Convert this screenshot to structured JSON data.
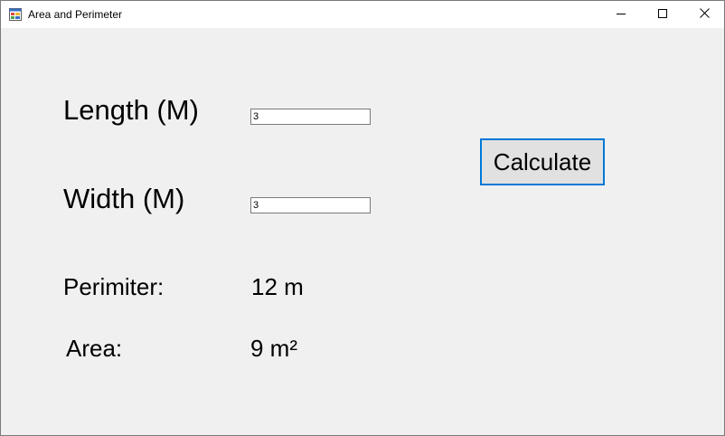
{
  "window": {
    "title": "Area and Perimeter",
    "app_icon": "windows-forms-app-icon",
    "accent_color": "#0078d7",
    "controls": {
      "minimize_icon": "minimize-icon",
      "maximize_icon": "maximize-icon",
      "close_icon": "close-icon"
    }
  },
  "form": {
    "length_label": "Length (M)",
    "length_value": "3",
    "width_label": "Width (M)",
    "width_value": "3",
    "calculate_label": "Calculate",
    "perimeter_label": "Perimiter:",
    "perimeter_value": "12 m",
    "area_label": "Area:",
    "area_value": "9 m²"
  }
}
